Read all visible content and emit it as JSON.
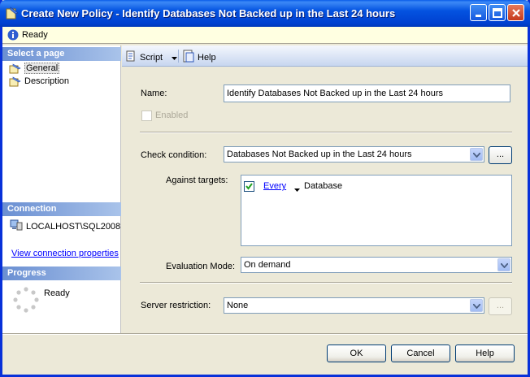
{
  "window": {
    "title": "Create New Policy - Identify Databases Not Backed up in the Last 24 hours"
  },
  "status": {
    "text": "Ready"
  },
  "left": {
    "select_page_header": "Select a page",
    "pages": [
      {
        "label": "General"
      },
      {
        "label": "Description"
      }
    ],
    "connection_header": "Connection",
    "server": "LOCALHOST\\SQL2008",
    "view_connection_link": "View connection properties",
    "progress_header": "Progress",
    "progress_status": "Ready"
  },
  "toolbar": {
    "script_label": "Script",
    "help_label": "Help"
  },
  "form": {
    "name_label": "Name:",
    "name_value": "Identify Databases Not Backed up in the Last 24 hours",
    "enabled_label": "Enabled",
    "check_condition_label": "Check condition:",
    "check_condition_value": "Databases Not Backed up in the Last 24 hours",
    "ellipsis": "...",
    "against_targets_label": "Against targets:",
    "target_every": "Every",
    "target_object": "Database",
    "evaluation_mode_label": "Evaluation Mode:",
    "evaluation_mode_value": "On demand",
    "server_restriction_label": "Server restriction:",
    "server_restriction_value": "None"
  },
  "buttons": {
    "ok": "OK",
    "cancel": "Cancel",
    "help": "Help"
  }
}
